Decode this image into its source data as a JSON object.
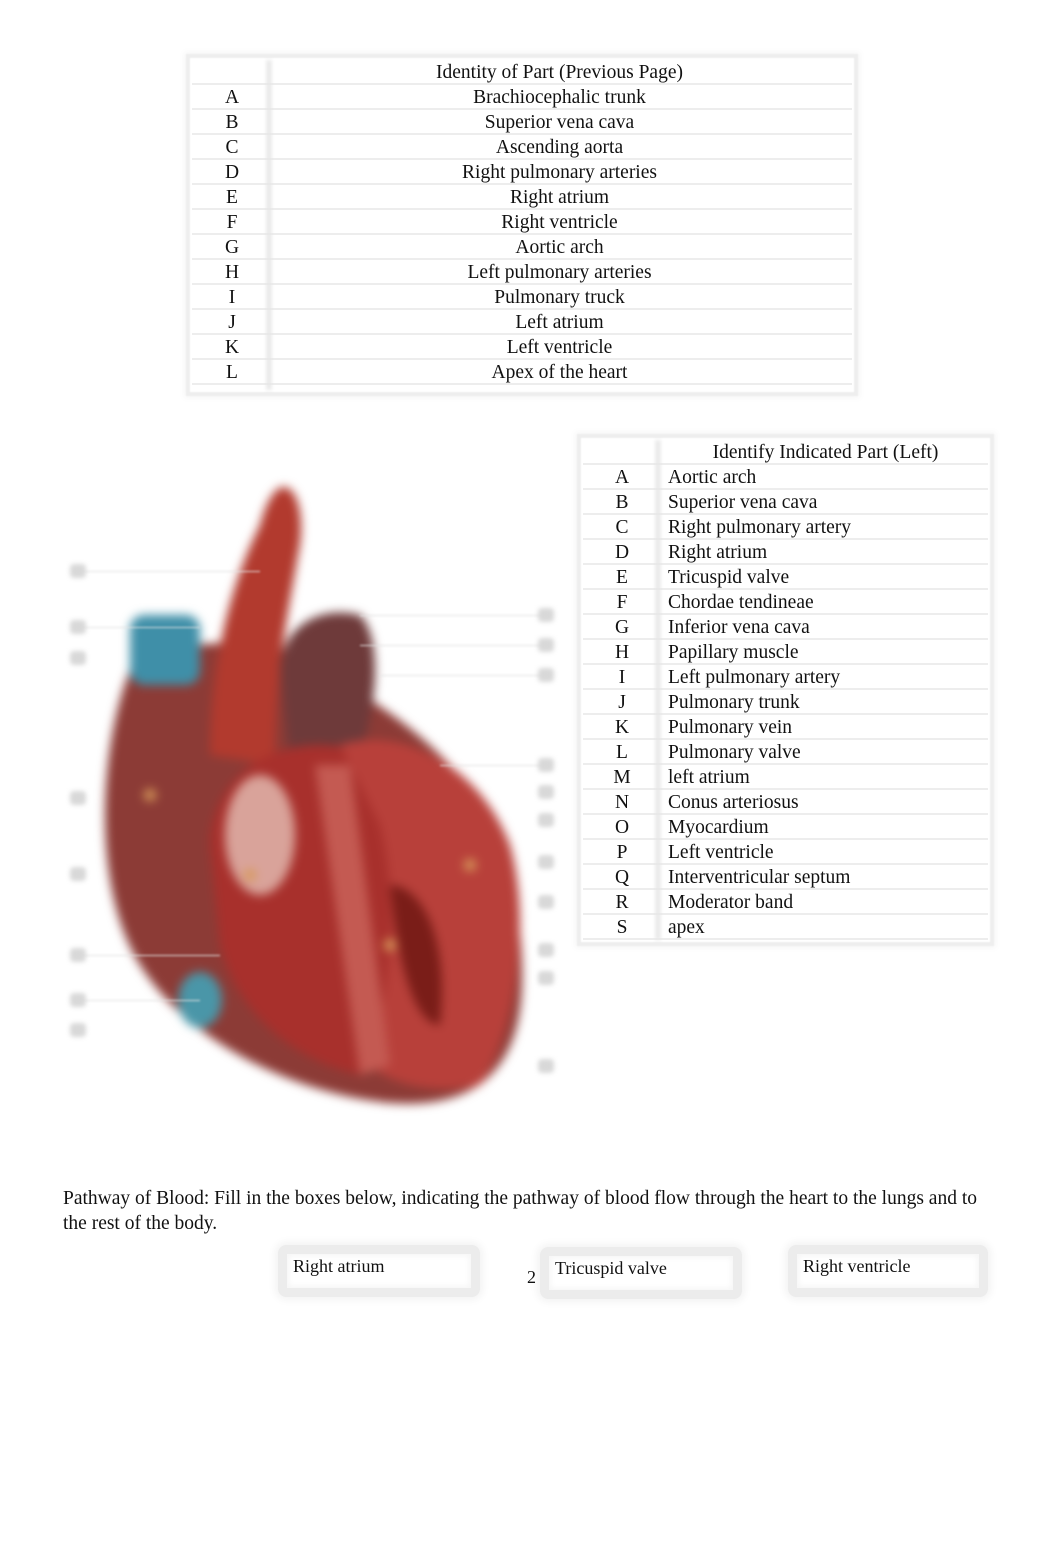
{
  "table_previous_page": {
    "header": "Identity of Part (Previous Page)",
    "rows": [
      {
        "key": "A",
        "value": "Brachiocephalic trunk"
      },
      {
        "key": "B",
        "value": "Superior vena cava"
      },
      {
        "key": "C",
        "value": "Ascending aorta"
      },
      {
        "key": "D",
        "value": "Right pulmonary arteries"
      },
      {
        "key": "E",
        "value": "Right atrium"
      },
      {
        "key": "F",
        "value": "Right ventricle"
      },
      {
        "key": "G",
        "value": "Aortic arch"
      },
      {
        "key": "H",
        "value": "Left pulmonary arteries"
      },
      {
        "key": "I",
        "value": "Pulmonary truck"
      },
      {
        "key": "J",
        "value": "Left atrium"
      },
      {
        "key": "K",
        "value": "Left ventricle"
      },
      {
        "key": "L",
        "value": "Apex of the heart"
      }
    ]
  },
  "table_indicated_parts": {
    "header": "Identify Indicated Part (Left)",
    "rows": [
      {
        "key": "A",
        "value": "Aortic arch"
      },
      {
        "key": "B",
        "value": "Superior vena cava"
      },
      {
        "key": "C",
        "value": "Right pulmonary artery"
      },
      {
        "key": "D",
        "value": "Right atrium"
      },
      {
        "key": "E",
        "value": "Tricuspid valve"
      },
      {
        "key": "F",
        "value": "Chordae tendineae"
      },
      {
        "key": "G",
        "value": "Inferior vena cava"
      },
      {
        "key": "H",
        "value": "Papillary muscle"
      },
      {
        "key": "I",
        "value": "Left pulmonary artery"
      },
      {
        "key": "J",
        "value": "Pulmonary trunk"
      },
      {
        "key": "K",
        "value": "Pulmonary vein"
      },
      {
        "key": "L",
        "value": "Pulmonary valve"
      },
      {
        "key": "M",
        "value": "left atrium"
      },
      {
        "key": "N",
        "value": "Conus arteriosus"
      },
      {
        "key": "O",
        "value": "Myocardium"
      },
      {
        "key": "P",
        "value": "Left ventricle"
      },
      {
        "key": "Q",
        "value": "Interventricular septum"
      },
      {
        "key": "R",
        "value": "Moderator band"
      },
      {
        "key": "S",
        "value": "apex"
      }
    ]
  },
  "diagram": {
    "subject": "heart cross-section illustration",
    "colors": {
      "muscle": "#a8302c",
      "dark_muscle": "#7a1d18",
      "vein": "#3f8fa8",
      "outer": "#8c3b36"
    }
  },
  "pathway": {
    "instructions": "Pathway of Blood:  Fill in the boxes below, indicating the pathway of blood flow through the heart to the lungs and to the rest of the body.",
    "boxes": [
      "Right atrium",
      "Tricuspid valve",
      "Right ventricle"
    ]
  },
  "page_number": "2"
}
